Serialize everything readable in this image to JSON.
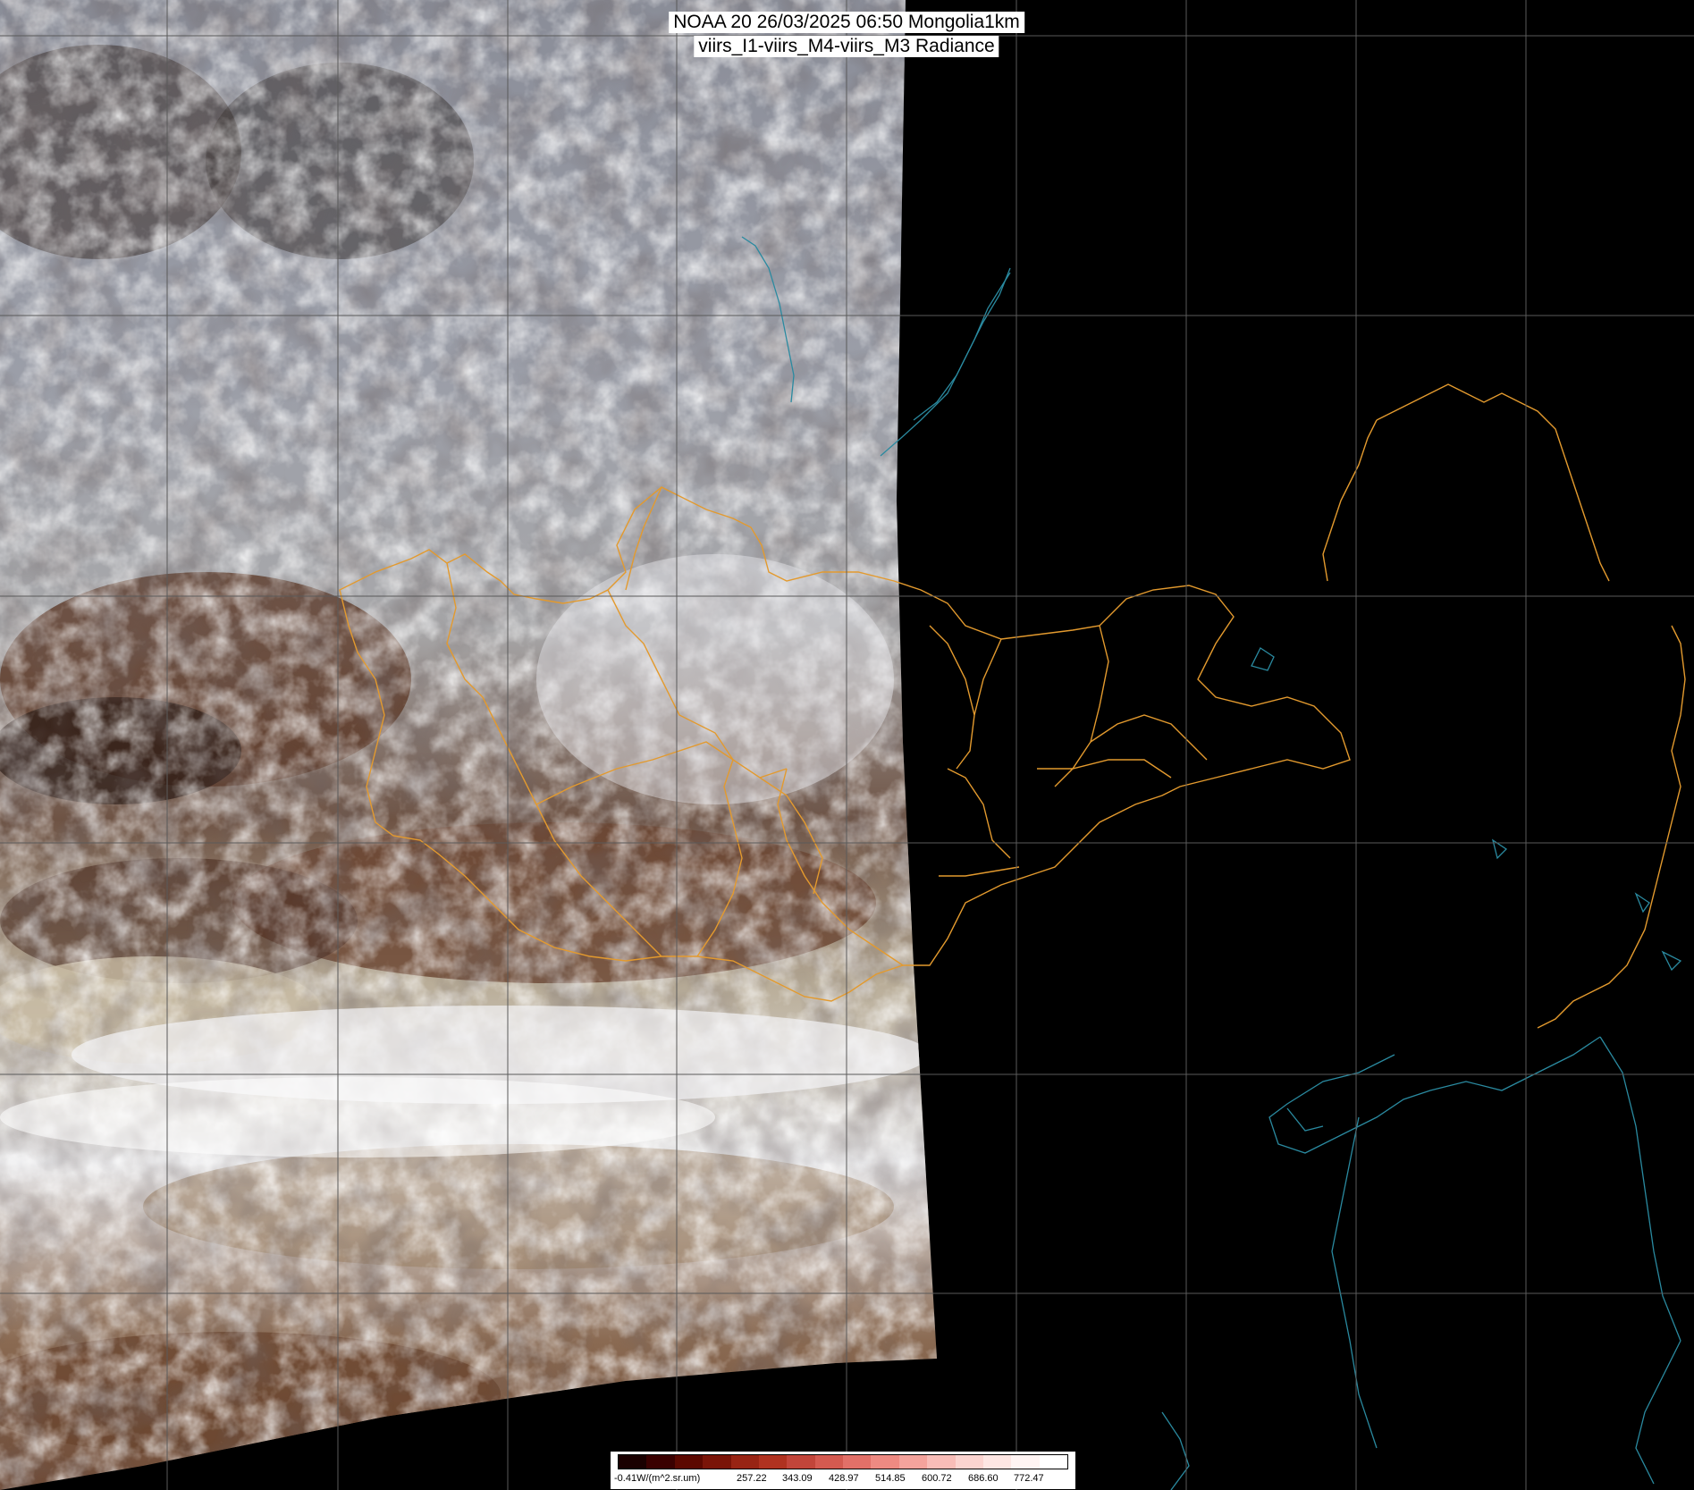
{
  "title": {
    "line1": "NOAA 20 26/03/2025 06:50 Mongolia1km",
    "line2": "viirs_I1-viirs_M4-viirs_M3 Radiance"
  },
  "colorbar": {
    "unit_label": "-0.41W/(m^2.sr.um)",
    "ticks": [
      "257.22",
      "343.09",
      "428.97",
      "514.85",
      "600.72",
      "686.60",
      "772.47"
    ],
    "colors": [
      "#1a0000",
      "#3a0000",
      "#5c0800",
      "#7a1408",
      "#982414",
      "#b03220",
      "#c2453a",
      "#d45a50",
      "#e27068",
      "#ee8a82",
      "#f4a39c",
      "#f8bdb8",
      "#fbd4d0",
      "#fde6e3",
      "#fff4f3",
      "#ffffff"
    ]
  },
  "map": {
    "background_color": "#000000",
    "grid_color": "#5a5a5a",
    "border_color": "#e39a2e",
    "coast_color": "#2a8aa0"
  }
}
